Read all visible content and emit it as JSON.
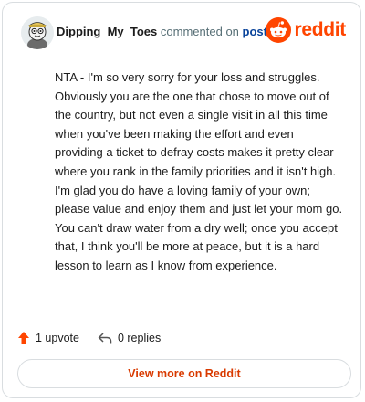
{
  "header": {
    "username": "Dipping_My_Toes",
    "action_text": "commented on",
    "post_link": "post",
    "brand_name": "reddit",
    "brand_color": "#ff4500"
  },
  "comment": {
    "text": "NTA - I'm so very sorry for your loss and struggles. Obviously you are the one that chose to move out of the country, but not even a single visit in all this time when you've been making the effort and even providing a ticket to defray costs makes it pretty clear where you rank in the family priorities and it isn't high. I'm glad you do have a loving family of your own; please value and enjoy them and just let your mom go. You can't draw water from a dry well; once you accept that, I think you'll be more at peace, but it is a hard lesson to learn as I know from experience."
  },
  "actions": {
    "upvote_label": "1 upvote",
    "replies_label": "0 replies"
  },
  "footer": {
    "view_more_label": "View more on Reddit"
  },
  "icons": {
    "avatar": "avatar-icon",
    "brand": "reddit-logo-icon",
    "upvote": "upvote-arrow-icon",
    "reply": "reply-arrow-icon"
  }
}
